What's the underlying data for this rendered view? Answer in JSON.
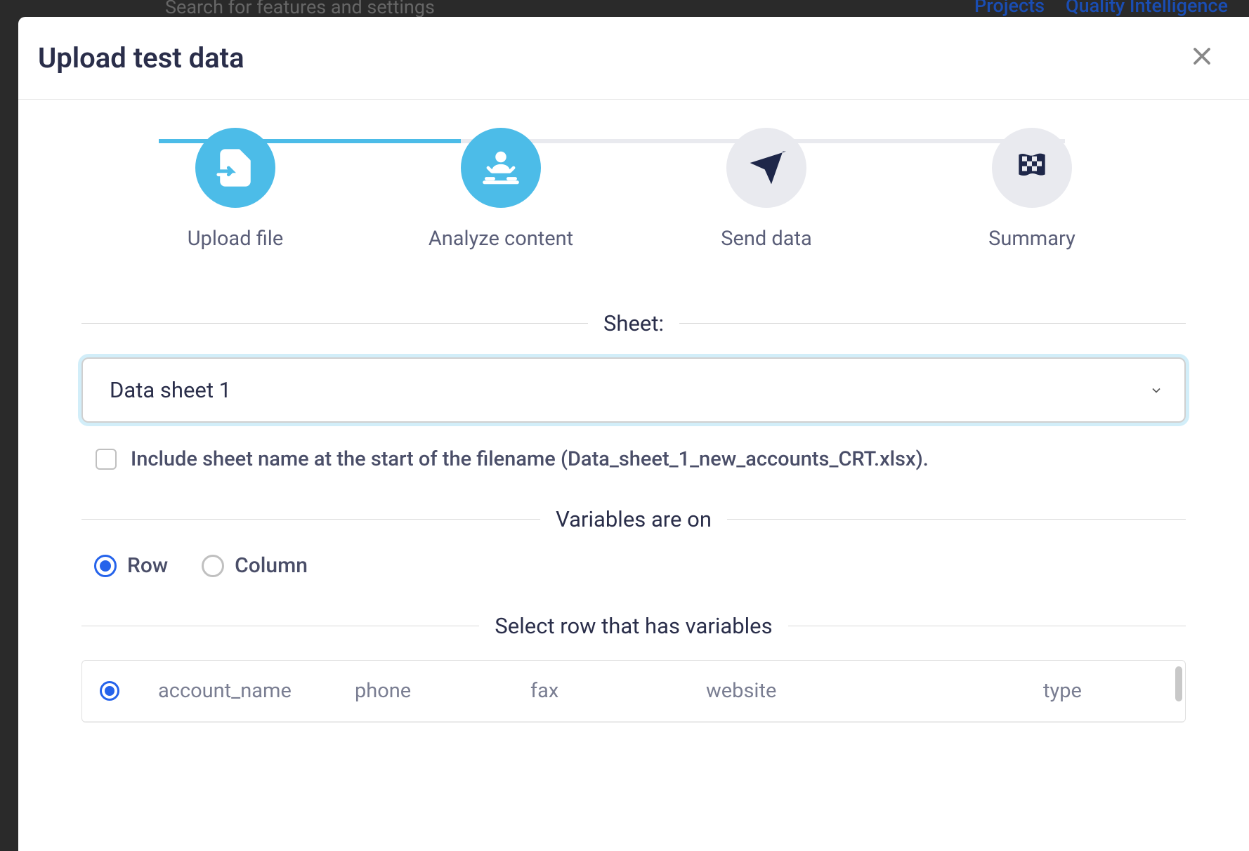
{
  "backdrop": {
    "search_placeholder": "Search for features and settings",
    "nav_projects": "Projects",
    "nav_quality": "Quality Intelligence"
  },
  "modal": {
    "title": "Upload test data"
  },
  "steps": [
    {
      "label": "Upload file"
    },
    {
      "label": "Analyze content"
    },
    {
      "label": "Send data"
    },
    {
      "label": "Summary"
    }
  ],
  "sections": {
    "sheet_title": "Sheet:",
    "variables_title": "Variables are on",
    "select_row_title": "Select row that has variables"
  },
  "sheet": {
    "selected": "Data sheet 1",
    "include_label": "Include sheet name at the start of the filename (Data_sheet_1_new_accounts_CRT.xlsx)."
  },
  "variables": {
    "row_label": "Row",
    "column_label": "Column"
  },
  "table": {
    "columns": [
      "account_name",
      "phone",
      "fax",
      "website",
      "type"
    ]
  }
}
